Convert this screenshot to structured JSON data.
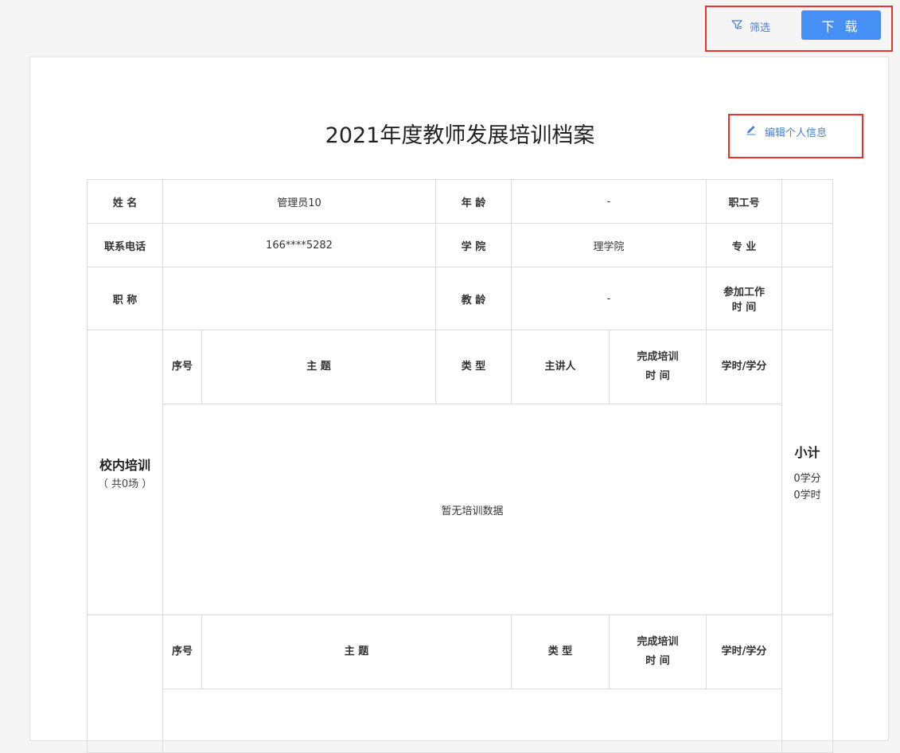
{
  "toolbar": {
    "filter_label": "筛选",
    "download_label": "下 载"
  },
  "document": {
    "title": "2021年度教师发展培训档案",
    "edit_label": "编辑个人信息"
  },
  "profile": {
    "name_label": "姓 名",
    "name_value": "管理员10",
    "age_label": "年 龄",
    "age_value": "-",
    "staff_id_label": "职工号",
    "staff_id_value": "",
    "phone_label": "联系电话",
    "phone_value": "166****5282",
    "college_label": "学 院",
    "college_value": "理学院",
    "major_label": "专 业",
    "major_value": "",
    "title_label": "职 称",
    "title_value": "",
    "teaching_years_label": "教 龄",
    "teaching_years_value": "-",
    "work_start_label_1": "参加工作",
    "work_start_label_2": "时 间",
    "work_start_value": ""
  },
  "campus_training": {
    "section_label": "校内培训",
    "section_count": "（ 共0场 ）",
    "columns": {
      "index": "序号",
      "topic": "主 题",
      "type": "类 型",
      "speaker": "主讲人",
      "finish_time_1": "完成培训",
      "finish_time_2": "时 间",
      "hours_credits": "学时/学分"
    },
    "empty_text": "暂无培训数据",
    "subtotal_label": "小计",
    "subtotal_credits": "0学分",
    "subtotal_hours": "0学时"
  },
  "second_training": {
    "columns": {
      "index": "序号",
      "topic": "主 题",
      "type": "类 型",
      "finish_time_1": "完成培训",
      "finish_time_2": "时 间",
      "hours_credits": "学时/学分"
    }
  },
  "colors": {
    "accent": "#4690f5",
    "link": "#4a7fd0",
    "highlight_border": "#e8322c"
  }
}
